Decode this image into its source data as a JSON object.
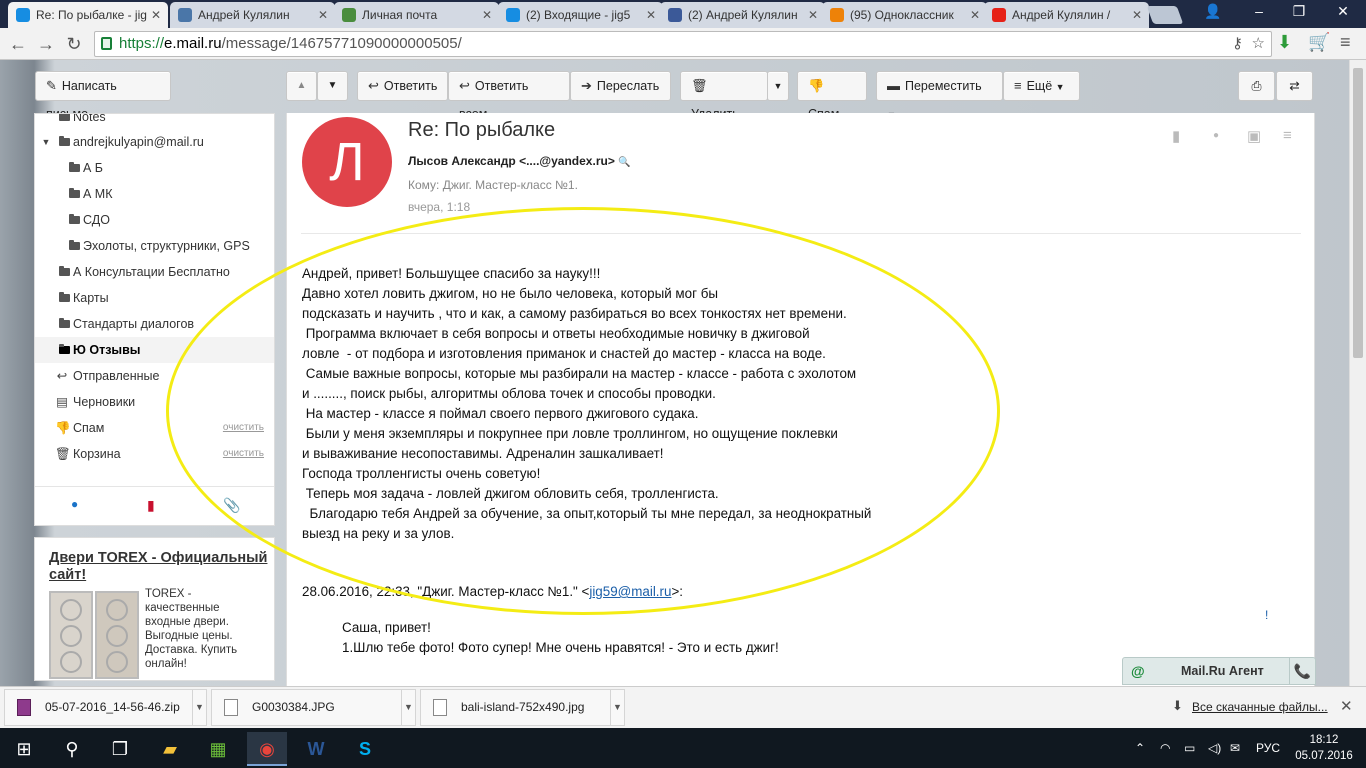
{
  "browser": {
    "tabs": [
      {
        "title": "Re: По рыбалке - jig",
        "icon": "mail-ru-icon",
        "color": "#168de2"
      },
      {
        "title": "Андрей Кулялин",
        "icon": "vk-icon",
        "color": "#4a76a8"
      },
      {
        "title": "Личная почта",
        "icon": "t-icon",
        "color": "#4a8d3e"
      },
      {
        "title": "(2) Входящие - jig5",
        "icon": "mail-ru-icon",
        "color": "#168de2"
      },
      {
        "title": "(2) Андрей Кулялин",
        "icon": "facebook-icon",
        "color": "#3b5998"
      },
      {
        "title": "(95) Одноклассник",
        "icon": "odnoklassniki-icon",
        "color": "#ee8208"
      },
      {
        "title": "Андрей Кулялин / ",
        "icon": "youtube-icon",
        "color": "#e62117"
      }
    ],
    "url": {
      "scheme": "https://",
      "host": "e.mail.ru",
      "path": "/message/14675771090000000505/"
    }
  },
  "toolbar": {
    "compose": "Написать письмо",
    "reply": "Ответить",
    "reply_all": "Ответить всем",
    "forward": "Переслать",
    "delete": "Удалить",
    "spam": "Спам",
    "move": "Переместить",
    "more": "Ещё"
  },
  "sidebar": {
    "folders": [
      {
        "label": "Notes",
        "icon": "folder-icon"
      },
      {
        "label": "andrejkulyapin@mail.ru",
        "icon": "folder-icon"
      },
      {
        "label": "А Б",
        "icon": "folder-icon"
      },
      {
        "label": "А МК",
        "icon": "folder-icon"
      },
      {
        "label": "СДО",
        "icon": "folder-icon"
      },
      {
        "label": "Эхолоты, структурники, GPS",
        "icon": "folder-icon"
      },
      {
        "label": "А Консультации Бесплатно",
        "icon": "folder-icon"
      },
      {
        "label": "Карты",
        "icon": "folder-icon"
      },
      {
        "label": "Стандарты диалогов",
        "icon": "folder-icon"
      },
      {
        "label": "Ю Отзывы",
        "icon": "folder-icon"
      },
      {
        "label": "Отправленные",
        "icon": "sent-icon"
      },
      {
        "label": "Черновики",
        "icon": "drafts-icon"
      },
      {
        "label": "Спам",
        "icon": "spam-icon",
        "action": "очистить"
      },
      {
        "label": "Корзина",
        "icon": "trash-icon",
        "action": "очистить"
      }
    ]
  },
  "ad": {
    "title": "Двери TOREX - Официальный сайт!",
    "lines": [
      "TOREX -",
      "качественные",
      "входные двери.",
      "Выгодные цены.",
      "Доставка. Купить",
      "онлайн!"
    ]
  },
  "message": {
    "avatar_letter": "Л",
    "avatar_color": "#e0434a",
    "subject": "Re: По рыбалке",
    "from_name": "Лысов Александр",
    "from_email": "<....@yandex.ru>",
    "to": "Кому: Джиг. Мастер-класс №1.",
    "date": "вчера, 1:18",
    "body": [
      "Андрей, привет! Большущее спасибо за науку!!!",
      "Давно хотел ловить джигом, но не было человека, который мог бы",
      "подсказать и научить , что и как, а самому разбираться во всех тонкостях нет времени.",
      " Программа включает в себя вопросы и ответы необходимые новичку в джиговой",
      "ловле  - от подбора и изготовления приманок и снастей до мастер - класса на воде.",
      " Самые важные вопросы, которые мы разбирали на мастер - классе - работа с эхолотом",
      "и ........, поиск рыбы, алгоритмы облова точек и способы проводки.",
      " На мастер - классе я поймал своего первого джигового судака.",
      " Были у меня экземпляры и покрупнее при ловле троллингом, но ощущение поклевки",
      "и вываживание несопоставимы. Адреналин зашкаливает!",
      "Господа тролленгисты очень советую!",
      " Теперь моя задача - ловлей джигом обловить себя, тролленгиста.",
      "  Благодарю тебя Андрей за обучение, за опыт,который ты мне передал, за неоднократный",
      "выезд на реку и за улов."
    ],
    "quote_header": "28.06.2016, 22:33, \"Джиг. Мастер-класс №1.\" <",
    "quote_email": "jig59@mail.ru",
    "quote_tail": ">:",
    "quote": [
      "Саша, привет!",
      "",
      "1.Шлю тебе фото! Фото супер! Мне очень нравятся! - Это и есть джиг!"
    ],
    "highlight_color": "#f4ec14"
  },
  "agent": {
    "label": "Mail.Ru Агент"
  },
  "downloads": {
    "items": [
      "05-07-2016_14-56-46.zip",
      "G0030384.JPG",
      "bali-island-752x490.jpg"
    ],
    "show_all": "Все скачанные файлы..."
  },
  "taskbar": {
    "lang": "РУС",
    "time": "18:12",
    "date": "05.07.2016"
  }
}
